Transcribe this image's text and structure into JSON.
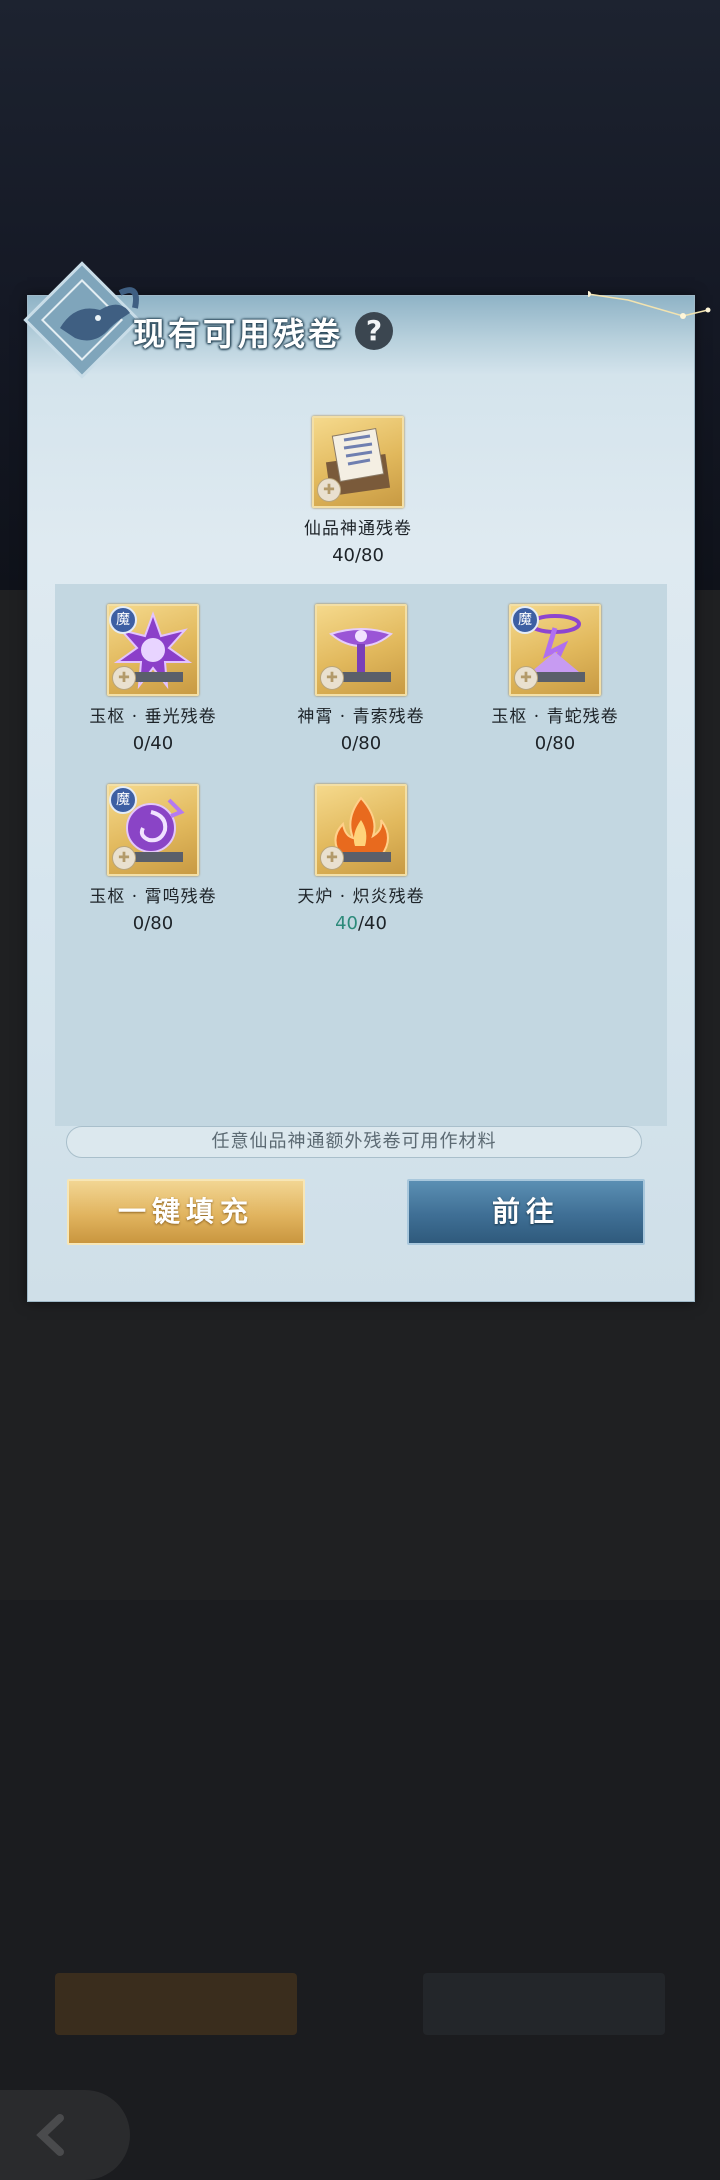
{
  "dialog": {
    "title": "现有可用残卷",
    "help_icon": "question-mark-icon",
    "help_label": "?"
  },
  "main_item": {
    "name": "仙品神通残卷",
    "count": "40/80",
    "icon": "scroll-pile-icon"
  },
  "items": [
    {
      "name": "玉枢 · 垂光残卷",
      "have": "0",
      "need": "/40",
      "badge": "魔",
      "icon": "purple-burst-icon"
    },
    {
      "name": "神霄 · 青索残卷",
      "have": "0",
      "need": "/80",
      "badge": "",
      "icon": "purple-sword-icon"
    },
    {
      "name": "玉枢 · 青蛇残卷",
      "have": "0",
      "need": "/80",
      "badge": "魔",
      "icon": "purple-serpent-icon"
    },
    {
      "name": "玉枢 · 霄鸣残卷",
      "have": "0",
      "need": "/80",
      "badge": "魔",
      "icon": "purple-vortex-icon"
    },
    {
      "name": "天炉 · 炽炎残卷",
      "have": "40",
      "need": "/40",
      "badge": "",
      "icon": "flame-icon"
    }
  ],
  "puzzle_badge": "✚",
  "note": "任意仙品神通额外残卷可用作材料",
  "buttons": {
    "fill": "一键填充",
    "goto": "前往"
  },
  "colors": {
    "gold_button": "#e1b45f",
    "blue_button": "#3f6f95",
    "have_complete": "#2c8a7a",
    "panel_bg": "#dfeaf1"
  }
}
